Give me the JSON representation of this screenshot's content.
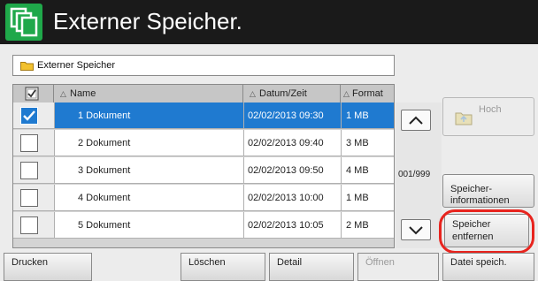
{
  "title": "Externer Speicher.",
  "path": "Externer Speicher",
  "columns": {
    "name": "Name",
    "date": "Datum/Zeit",
    "format": "Format"
  },
  "rows": [
    {
      "name": "1 Dokument",
      "date": "02/02/2013 09:30",
      "size": "1 MB",
      "checked": true,
      "selected": true
    },
    {
      "name": "2 Dokument",
      "date": "02/02/2013 09:40",
      "size": "3 MB",
      "checked": false,
      "selected": false
    },
    {
      "name": "3 Dokument",
      "date": "02/02/2013 09:50",
      "size": "4 MB",
      "checked": false,
      "selected": false
    },
    {
      "name": "4 Dokument",
      "date": "02/02/2013 10:00",
      "size": "1 MB",
      "checked": false,
      "selected": false
    },
    {
      "name": "5 Dokument",
      "date": "02/02/2013 10:05",
      "size": "2 MB",
      "checked": false,
      "selected": false
    }
  ],
  "pager": {
    "counter": "001/999"
  },
  "side": {
    "up_label": "Hoch",
    "info_label_1": "Speicher-",
    "info_label_2": "informationen",
    "remove_label_1": "Speicher",
    "remove_label_2": "entfernen"
  },
  "bottom": {
    "print": "Drucken",
    "delete": "Löschen",
    "detail": "Detail",
    "open": "Öffnen",
    "save": "Datei speich."
  },
  "colors": {
    "title_bar": "#1a1a1a",
    "app_icon": "#1fa84a",
    "selection": "#1f7ad0",
    "highlight_ring": "#e8241e"
  },
  "icons": {
    "app": "multi-page-copy-icon",
    "folder": "folder-icon",
    "up": "folder-up-icon"
  }
}
